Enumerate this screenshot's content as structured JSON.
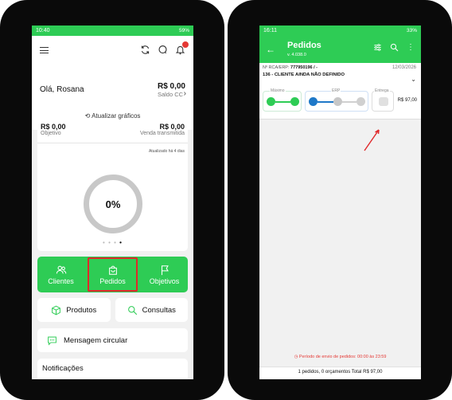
{
  "left": {
    "status": {
      "time": "10:40",
      "right": "59%"
    },
    "greeting": "Olá, Rosana",
    "saldo": {
      "value": "R$ 0,00",
      "label": "Saldo CC"
    },
    "refresh_label": "Atualizar gráficos",
    "goal": {
      "objetivo_value": "R$ 0,00",
      "objetivo_label": "Objetivo",
      "venda_value": "R$ 0,00",
      "venda_label": "Venda transmitida",
      "updated": "Atualizado há 4 dias",
      "percent": "0%"
    },
    "nav": {
      "clientes": "Clientes",
      "pedidos": "Pedidos",
      "objetivos": "Objetivos"
    },
    "buttons": {
      "produtos": "Produtos",
      "consultas": "Consultas"
    },
    "message": "Mensagem circular",
    "notifications": "Notificações",
    "colors": {
      "accent": "#2ecc55",
      "highlight": "#e0282a"
    }
  },
  "right": {
    "status": {
      "time": "16:11",
      "right": "33%"
    },
    "title": "Pedidos",
    "version": "v. 4.038.0",
    "order": {
      "rca_label": "Nº RCA/ERP:",
      "rca_value": "777950196 / -",
      "date": "12/03/2026",
      "client": "136 - CLIENTE AINDA NÃO DEFINIDO",
      "stage_maximo": "Máximo",
      "stage_erp": "ERP",
      "stage_entrega": "Entrega",
      "value": "R$ 97,00"
    },
    "periodo": "Período de envio de pedidos: 00:00 às 23:59",
    "footer": "1 pedidos, 0 orçamentos  Total R$ 97,00"
  }
}
